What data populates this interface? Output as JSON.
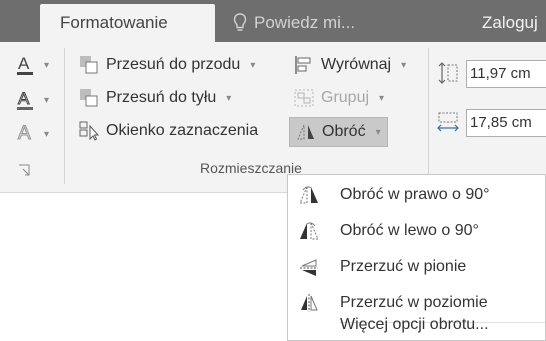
{
  "tabs": {
    "active": "Formatowanie",
    "tell_me": "Powiedz mi...",
    "login": "Zaloguj"
  },
  "ribbon": {
    "arrange_group_label": "Rozmieszczanie",
    "bring_forward": "Przesuń do przodu",
    "send_backward": "Przesuń do tyłu",
    "selection_pane": "Okienko zaznaczenia",
    "align": "Wyrównaj",
    "group": "Grupuj",
    "rotate": "Obróć",
    "height_value": "11,97 cm",
    "width_value": "17,85 cm"
  },
  "rotate_menu": {
    "items": [
      {
        "label": "Obróć w prawo o 90°",
        "icon": "rotate-right-90-icon"
      },
      {
        "label": "Obróć w lewo o 90°",
        "icon": "rotate-left-90-icon"
      },
      {
        "label": "Przerzuć w pionie",
        "icon": "flip-vertical-icon"
      },
      {
        "label": "Przerzuć w poziomie",
        "icon": "flip-horizontal-icon"
      }
    ],
    "more_options": "Więcej opcji obrotu..."
  },
  "colors": {
    "title_bar": "#6e6e6e",
    "ribbon_bg": "#f3f3f3",
    "pressed_bg": "#c9c9c9"
  }
}
